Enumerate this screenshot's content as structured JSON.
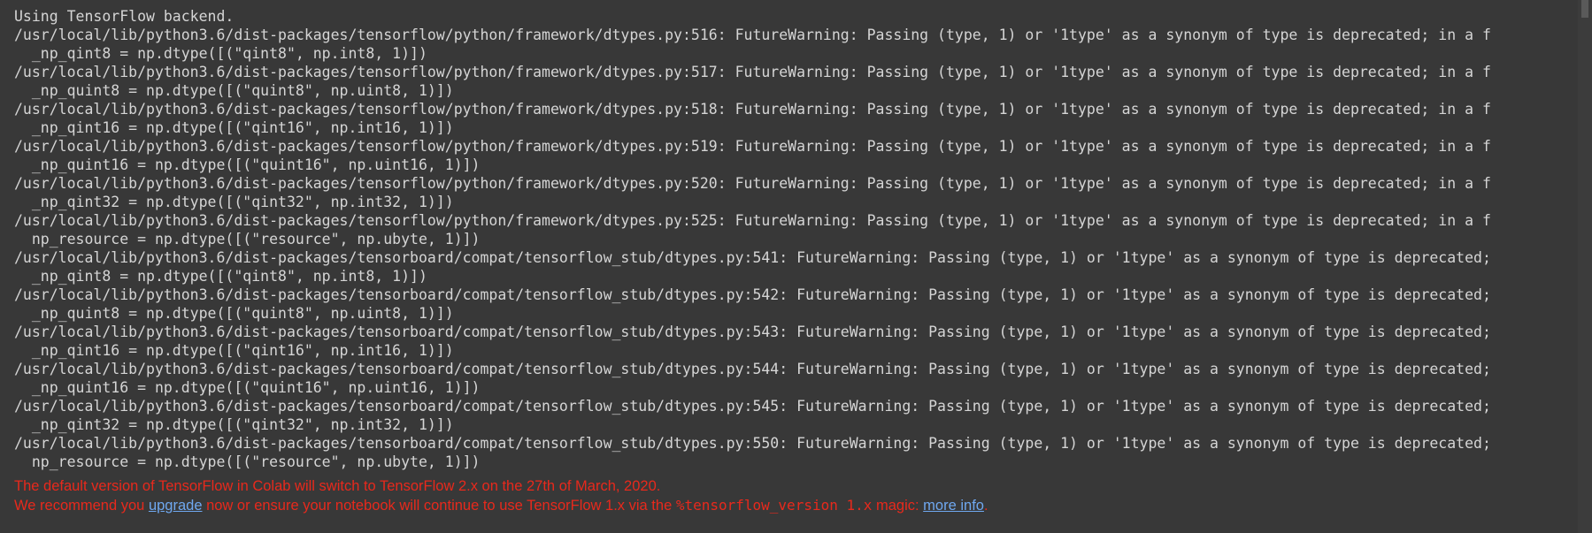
{
  "log": {
    "lines": [
      "Using TensorFlow backend.",
      "/usr/local/lib/python3.6/dist-packages/tensorflow/python/framework/dtypes.py:516: FutureWarning: Passing (type, 1) or '1type' as a synonym of type is deprecated; in a f",
      "  _np_qint8 = np.dtype([(\"qint8\", np.int8, 1)])",
      "/usr/local/lib/python3.6/dist-packages/tensorflow/python/framework/dtypes.py:517: FutureWarning: Passing (type, 1) or '1type' as a synonym of type is deprecated; in a f",
      "  _np_quint8 = np.dtype([(\"quint8\", np.uint8, 1)])",
      "/usr/local/lib/python3.6/dist-packages/tensorflow/python/framework/dtypes.py:518: FutureWarning: Passing (type, 1) or '1type' as a synonym of type is deprecated; in a f",
      "  _np_qint16 = np.dtype([(\"qint16\", np.int16, 1)])",
      "/usr/local/lib/python3.6/dist-packages/tensorflow/python/framework/dtypes.py:519: FutureWarning: Passing (type, 1) or '1type' as a synonym of type is deprecated; in a f",
      "  _np_quint16 = np.dtype([(\"quint16\", np.uint16, 1)])",
      "/usr/local/lib/python3.6/dist-packages/tensorflow/python/framework/dtypes.py:520: FutureWarning: Passing (type, 1) or '1type' as a synonym of type is deprecated; in a f",
      "  _np_qint32 = np.dtype([(\"qint32\", np.int32, 1)])",
      "/usr/local/lib/python3.6/dist-packages/tensorflow/python/framework/dtypes.py:525: FutureWarning: Passing (type, 1) or '1type' as a synonym of type is deprecated; in a f",
      "  np_resource = np.dtype([(\"resource\", np.ubyte, 1)])",
      "/usr/local/lib/python3.6/dist-packages/tensorboard/compat/tensorflow_stub/dtypes.py:541: FutureWarning: Passing (type, 1) or '1type' as a synonym of type is deprecated;",
      "  _np_qint8 = np.dtype([(\"qint8\", np.int8, 1)])",
      "/usr/local/lib/python3.6/dist-packages/tensorboard/compat/tensorflow_stub/dtypes.py:542: FutureWarning: Passing (type, 1) or '1type' as a synonym of type is deprecated;",
      "  _np_quint8 = np.dtype([(\"quint8\", np.uint8, 1)])",
      "/usr/local/lib/python3.6/dist-packages/tensorboard/compat/tensorflow_stub/dtypes.py:543: FutureWarning: Passing (type, 1) or '1type' as a synonym of type is deprecated;",
      "  _np_qint16 = np.dtype([(\"qint16\", np.int16, 1)])",
      "/usr/local/lib/python3.6/dist-packages/tensorboard/compat/tensorflow_stub/dtypes.py:544: FutureWarning: Passing (type, 1) or '1type' as a synonym of type is deprecated;",
      "  _np_quint16 = np.dtype([(\"quint16\", np.uint16, 1)])",
      "/usr/local/lib/python3.6/dist-packages/tensorboard/compat/tensorflow_stub/dtypes.py:545: FutureWarning: Passing (type, 1) or '1type' as a synonym of type is deprecated;",
      "  _np_qint32 = np.dtype([(\"qint32\", np.int32, 1)])",
      "/usr/local/lib/python3.6/dist-packages/tensorboard/compat/tensorflow_stub/dtypes.py:550: FutureWarning: Passing (type, 1) or '1type' as a synonym of type is deprecated;",
      "  np_resource = np.dtype([(\"resource\", np.ubyte, 1)])"
    ]
  },
  "notice": {
    "line1": "The default version of TensorFlow in Colab will switch to TensorFlow 2.x on the 27th of March, 2020.",
    "line2_prefix": "We recommend you ",
    "upgrade_link": "upgrade",
    "line2_middle": " now or ensure your notebook will continue to use TensorFlow 1.x via the ",
    "magic_code": "%tensorflow_version 1.x",
    "line2_after_code": " magic: ",
    "more_info_link": "more info",
    "line2_suffix": "."
  },
  "colors": {
    "background": "#383838",
    "log_text": "#d5d5d5",
    "warning_red": "#e8291c",
    "link_blue": "#6fa8f0"
  }
}
